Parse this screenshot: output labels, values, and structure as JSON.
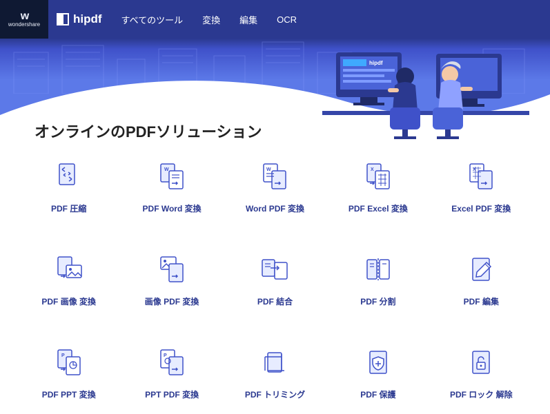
{
  "brand": {
    "w": "w",
    "name": "wondershare"
  },
  "logo": "hipdf",
  "nav": {
    "all_tools": "すべてのツール",
    "convert": "変換",
    "edit": "編集",
    "ocr": "OCR"
  },
  "hero": {
    "title": "オンラインのPDFソリューション",
    "screen_label": "hipdf"
  },
  "tools": [
    {
      "label": "PDF 圧縮"
    },
    {
      "label": "PDF Word 変換"
    },
    {
      "label": "Word PDF 変換"
    },
    {
      "label": "PDF Excel 変換"
    },
    {
      "label": "Excel PDF 変換"
    },
    {
      "label": "PDF 画像 変換"
    },
    {
      "label": "画像 PDF 変換"
    },
    {
      "label": "PDF 結合"
    },
    {
      "label": "PDF 分割"
    },
    {
      "label": "PDF 編集"
    },
    {
      "label": "PDF PPT 変換"
    },
    {
      "label": "PPT PDF 変換"
    },
    {
      "label": "PDF トリミング"
    },
    {
      "label": "PDF 保護"
    },
    {
      "label": "PDF ロック 解除"
    }
  ],
  "colors": {
    "accent": "#2b3990",
    "light": "#e7ecff",
    "stroke": "#3f51c9"
  }
}
